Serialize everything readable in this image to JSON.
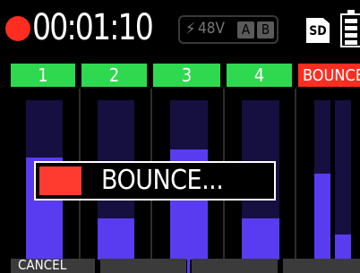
{
  "status": {
    "time": "00:01:10",
    "phantom_voltage": "48V",
    "phantom_a": "A",
    "phantom_b": "B",
    "sd_label": "SD",
    "recording_color": "#ff2d20"
  },
  "tracks": [
    {
      "label": "1",
      "level": 0.64
    },
    {
      "label": "2",
      "level": 0.26
    },
    {
      "label": "3",
      "level": 0.69
    },
    {
      "label": "4",
      "level": 0.26
    }
  ],
  "bounce": {
    "header": "BOUNCE",
    "left_level": 0.54,
    "right_level": 0.16
  },
  "dialog": {
    "text": "BOUNCE...",
    "progress": 0.18
  },
  "softkeys": {
    "cancel": "CANCEL"
  },
  "colors": {
    "track_header": "#2fd94f",
    "bounce_header": "#ff2d20",
    "meter_fill": "#5a3cf0",
    "meter_bg": "#151040"
  }
}
